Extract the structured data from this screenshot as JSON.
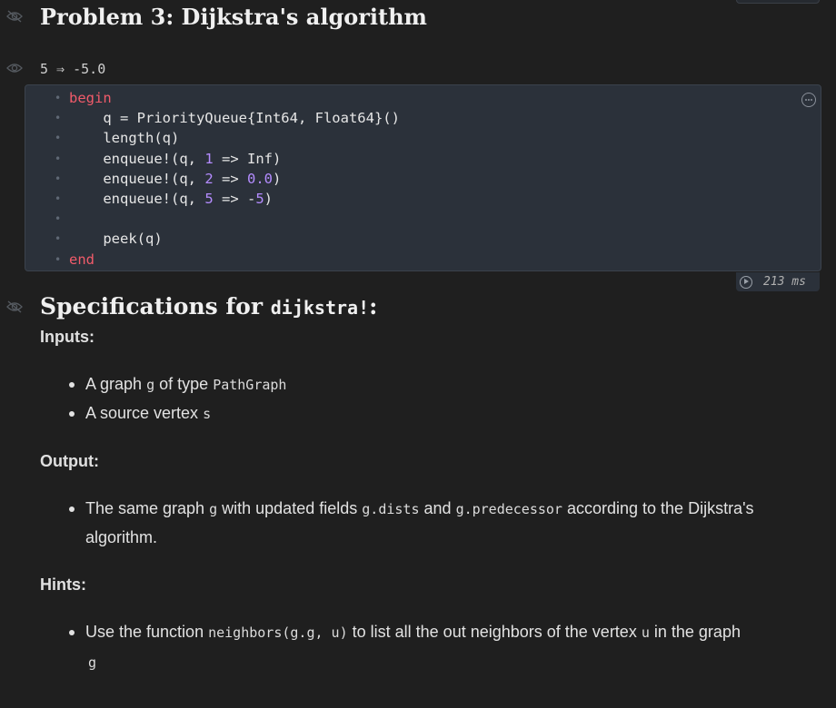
{
  "heading": {
    "title": "Problem 3: Dijkstra's algorithm"
  },
  "cell_output": {
    "text": "5 ⇒ -5.0"
  },
  "code": {
    "lines": [
      {
        "t": "begin"
      },
      {
        "t": "    q = PriorityQueue{Int64, Float64}()"
      },
      {
        "t": "    length(q)"
      },
      {
        "t": "    enqueue!(q, 1 => Inf)"
      },
      {
        "t": "    enqueue!(q, 2 => 0.0)"
      },
      {
        "t": "    enqueue!(q, 5 => -5)"
      },
      {
        "t": ""
      },
      {
        "t": "    peek(q)"
      },
      {
        "t": "end"
      }
    ]
  },
  "runtime": {
    "text": "213 ms"
  },
  "spec": {
    "title_prefix": "Specifications for",
    "title_code": "dijkstra!",
    "title_suffix": ":",
    "inputs_label": "Inputs:",
    "input1": {
      "a": "A graph",
      "code1": "g",
      "b": "of type",
      "code2": "PathGraph"
    },
    "input2": {
      "a": "A source vertex",
      "code1": "s"
    },
    "output_label": "Output:",
    "output1": {
      "a": "The same graph",
      "code1": "g",
      "b": "with updated fields",
      "code2": "g.dists",
      "c": "and",
      "code3": "g.predecessor",
      "d": "according to the Dijkstra's",
      "e": "algorithm."
    },
    "hints_label": "Hints:",
    "hint1": {
      "a": "Use the function",
      "code1": "neighbors(g.g, u)",
      "b": "to list all the out neighbors of the vertex",
      "code2": "u",
      "c": "in the graph",
      "code3": "g"
    }
  },
  "colors": {
    "background": "#1f1f1f",
    "code_bg": "#2b313a",
    "keyword": "#f15b6a",
    "number": "#b48cff"
  },
  "icons": [
    "eye-slash-icon",
    "eye-icon",
    "cell-options-icon",
    "play-circle-icon"
  ]
}
